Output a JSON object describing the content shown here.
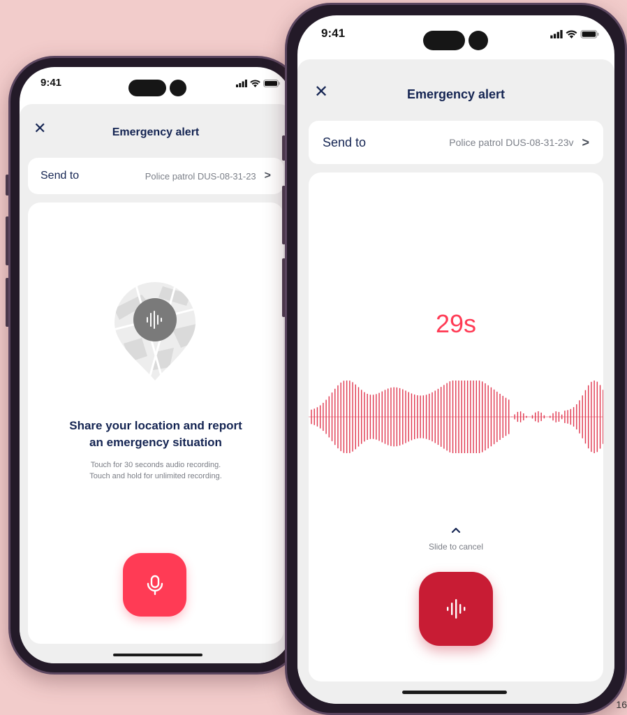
{
  "colors": {
    "background": "#f2cccb",
    "navy": "#142452",
    "accent_red": "#ff3b55",
    "recording_red": "#c81c34",
    "wave_red": "#e0344c",
    "sheet_gray": "#efefef"
  },
  "phone_left": {
    "status": {
      "time": "9:41"
    },
    "header": {
      "close_icon": "close-icon",
      "title": "Emergency alert"
    },
    "send_to": {
      "label": "Send to",
      "value": "Police patrol DUS-08-31-23"
    },
    "content": {
      "pin_icon": "map-pin-audio-icon",
      "heading_line1": "Share your location and report",
      "heading_line2": "an emergency situation",
      "sub_line1": "Touch for 30 seconds audio recording.",
      "sub_line2": "Touch and hold for unlimited recording."
    },
    "record_button": {
      "icon": "microphone-icon"
    }
  },
  "phone_right": {
    "status": {
      "time": "9:41"
    },
    "header": {
      "close_icon": "close-icon",
      "title": "Emergency alert"
    },
    "send_to": {
      "label": "Send to",
      "value": "Police patrol DUS-08-31-23v"
    },
    "recording": {
      "timer": "29s",
      "cancel_icon": "chevron-up-icon",
      "cancel_label": "Slide to cancel"
    },
    "record_button": {
      "icon": "audio-wave-icon"
    }
  },
  "page_number": "16"
}
